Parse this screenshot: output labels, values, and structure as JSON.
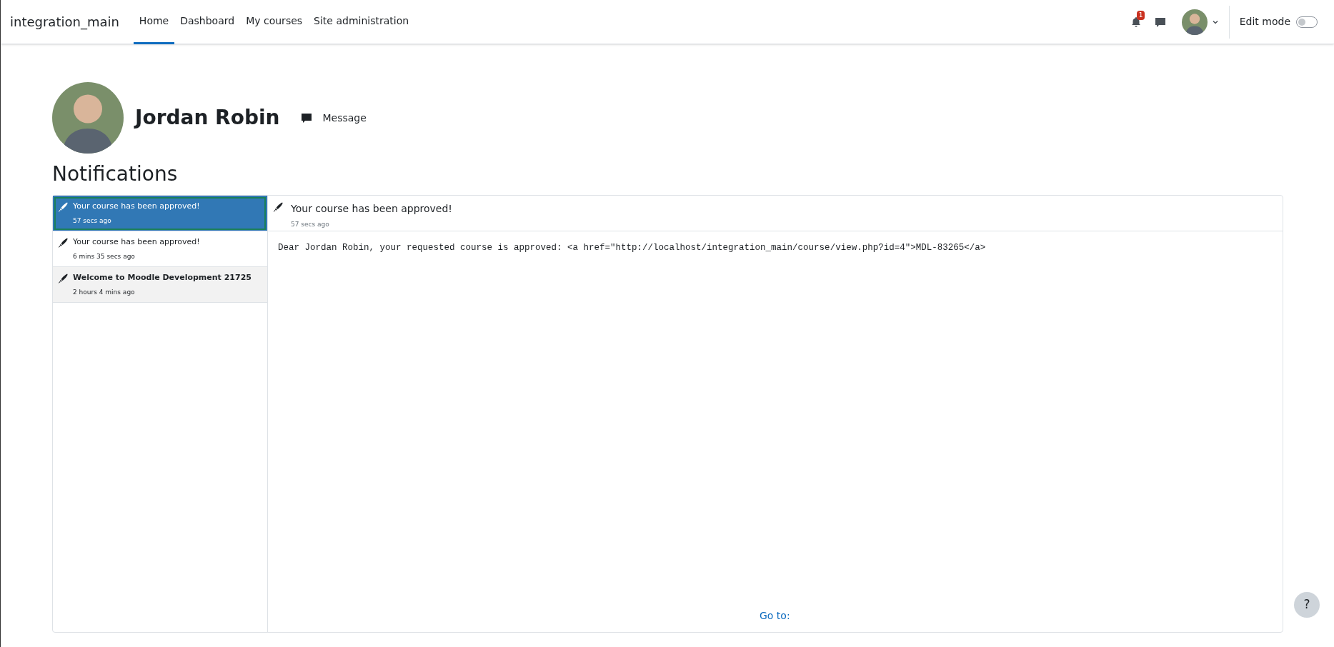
{
  "navbar": {
    "site_name": "integration_main",
    "links": [
      {
        "label": "Home",
        "selected": true
      },
      {
        "label": "Dashboard",
        "selected": false
      },
      {
        "label": "My courses",
        "selected": false
      },
      {
        "label": "Site administration",
        "selected": false
      }
    ],
    "notification_count": "1",
    "edit_mode": {
      "label": "Edit mode",
      "on": false
    }
  },
  "profile": {
    "name": "Jordan Robin",
    "message_label": "Message"
  },
  "heading": "Notifications",
  "notifications": [
    {
      "title": "Your course has been approved!",
      "time": "57 secs ago",
      "selected": true,
      "unread": false
    },
    {
      "title": "Your course has been approved!",
      "time": "6 mins 35 secs ago",
      "selected": false,
      "unread": false
    },
    {
      "title": "Welcome to Moodle Development 21725",
      "time": "2 hours 4 mins ago",
      "selected": false,
      "unread": true
    }
  ],
  "detail": {
    "title": "Your course has been approved!",
    "time": "57 secs ago",
    "body": "Dear Jordan Robin, your requested course is approved: <a href=\"http://localhost/integration_main/course/view.php?id=4\">MDL-83265</a>",
    "goto": "Go to:"
  },
  "help": "?"
}
